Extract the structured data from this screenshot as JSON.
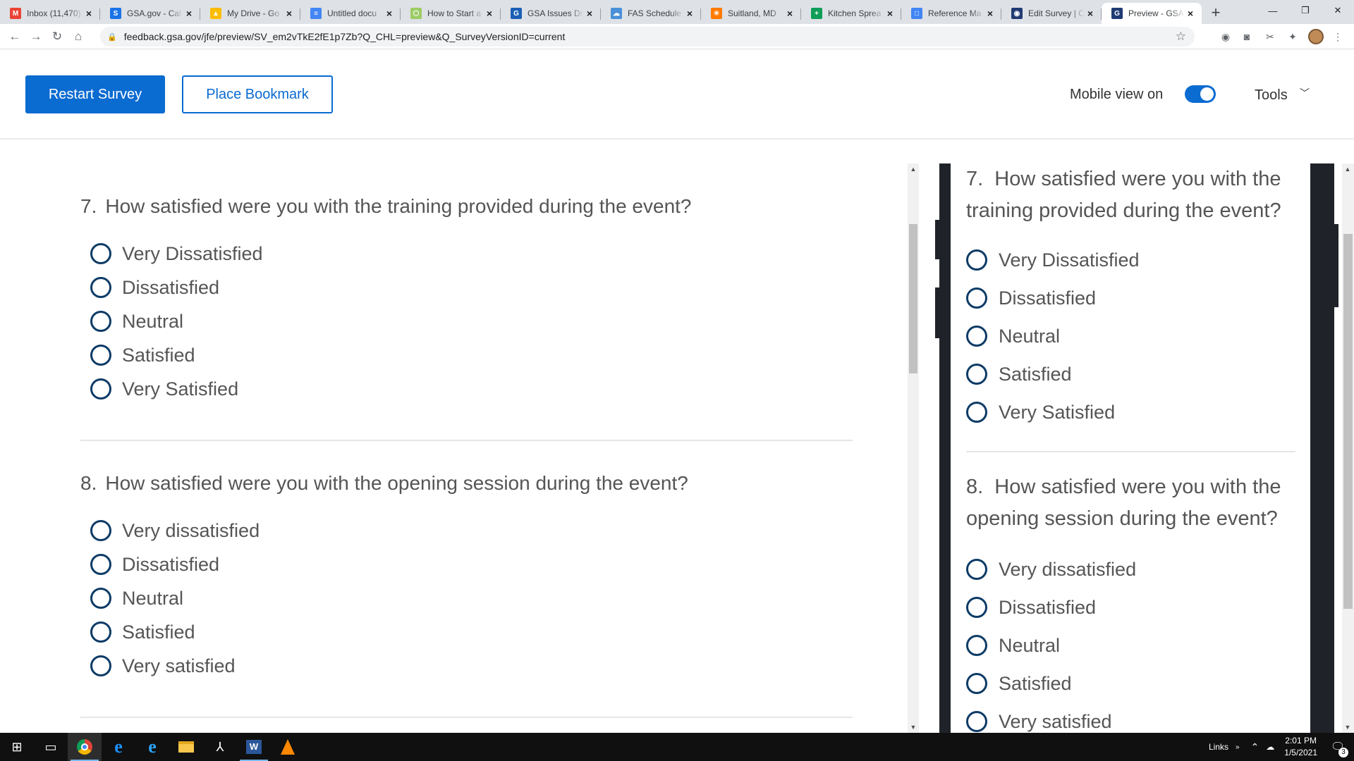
{
  "browser": {
    "tabs": [
      {
        "title": "Inbox (11,470)",
        "icon": "gmail-icon",
        "color": "#ea4335",
        "glyph": "M"
      },
      {
        "title": "GSA.gov - Cal",
        "icon": "gsa-icon",
        "color": "#1a73e8",
        "glyph": "S"
      },
      {
        "title": "My Drive - Go",
        "icon": "drive-icon",
        "color": "#fbbc04",
        "glyph": "▲"
      },
      {
        "title": "Untitled docu",
        "icon": "docs-icon",
        "color": "#4285f4",
        "glyph": "≡"
      },
      {
        "title": "How to Start a",
        "icon": "shield-icon",
        "color": "#9ccc65",
        "glyph": "⬡"
      },
      {
        "title": "GSA Issues Dr",
        "icon": "gsa-news-icon",
        "color": "#1a5fb4",
        "glyph": "G"
      },
      {
        "title": "FAS Schedule",
        "icon": "fas-icon",
        "color": "#4a90d9",
        "glyph": "☁"
      },
      {
        "title": "Suitland, MD",
        "icon": "weather-icon",
        "color": "#ff7a00",
        "glyph": "☀"
      },
      {
        "title": "Kitchen Sprea",
        "icon": "sheets-icon",
        "color": "#0f9d58",
        "glyph": "+"
      },
      {
        "title": "Reference Ma",
        "icon": "forms-icon",
        "color": "#4285f4",
        "glyph": "□"
      },
      {
        "title": "Edit Survey | C",
        "icon": "gsa-seal-icon",
        "color": "#1f3b73",
        "glyph": "◉"
      },
      {
        "title": "Preview - GSA",
        "icon": "gsa-preview-icon",
        "color": "#1f3b73",
        "glyph": "G",
        "active": true
      }
    ],
    "url": "feedback.gsa.gov/jfe/preview/SV_em2vTkE2fE1p7Zb?Q_CHL=preview&Q_SurveyVersionID=current"
  },
  "header": {
    "restart_label": "Restart Survey",
    "bookmark_label": "Place Bookmark",
    "mobile_view_label": "Mobile view on",
    "tools_label": "Tools"
  },
  "questions": [
    {
      "number": "7.",
      "text": "How satisfied were you with the training provided during the event?",
      "mobile_line1": "7.  How satisfied were you with the",
      "mobile_line2": "training provided during the event?",
      "options": [
        "Very Dissatisfied",
        "Dissatisfied",
        "Neutral",
        "Satisfied",
        "Very Satisfied"
      ]
    },
    {
      "number": "8.",
      "text": "How satisfied were you with the opening session during the event?",
      "mobile_line1": "8.  How satisfied were you with the",
      "mobile_line2": "opening session during the event?",
      "options": [
        "Very dissatisfied",
        "Dissatisfied",
        "Neutral",
        "Satisfied",
        "Very satisfied"
      ]
    }
  ],
  "taskbar": {
    "links_label": "Links",
    "time": "2:01 PM",
    "date": "1/5/2021",
    "notifications": "3"
  }
}
